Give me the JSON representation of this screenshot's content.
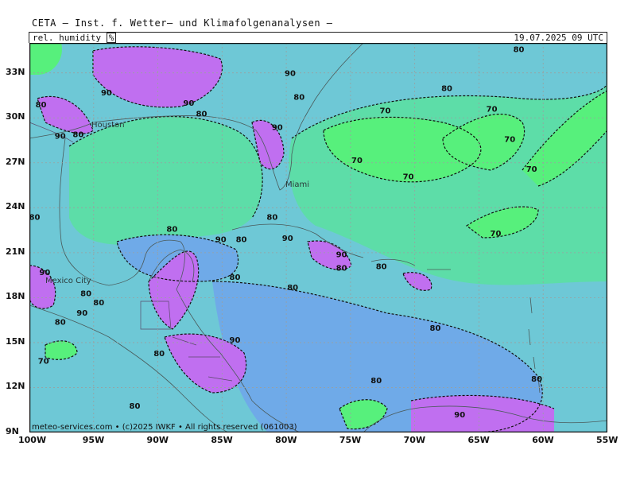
{
  "header": {
    "title": "CETA – Inst. f. Wetter– und Klimafolgenanalysen –",
    "parameter": "rel. humidity",
    "unit": "%",
    "valid_time": "19.07.2025 09 UTC"
  },
  "map": {
    "region": "Gulf of Mexico / Caribbean",
    "lon_range": [
      -100,
      -55
    ],
    "lat_range": [
      9,
      35
    ],
    "lon_ticks": [
      "100W",
      "95W",
      "90W",
      "85W",
      "80W",
      "75W",
      "70W",
      "65W",
      "60W",
      "55W"
    ],
    "lat_ticks": [
      "33N",
      "30N",
      "27N",
      "24N",
      "21N",
      "18N",
      "15N",
      "12N",
      "9N"
    ],
    "city_labels": [
      "Houston",
      "Miami",
      "Mexico City"
    ],
    "contour_labels": [
      {
        "text": "90",
        "lon": -94,
        "lat": 31.5
      },
      {
        "text": "90",
        "lon": -97.6,
        "lat": 28.6
      },
      {
        "text": "80",
        "lon": -96.2,
        "lat": 28.7
      },
      {
        "text": "80",
        "lon": -99.1,
        "lat": 30.7
      },
      {
        "text": "90",
        "lon": -87.6,
        "lat": 30.8
      },
      {
        "text": "80",
        "lon": -86.6,
        "lat": 30.1
      },
      {
        "text": "90",
        "lon": -79.7,
        "lat": 32.8
      },
      {
        "text": "80",
        "lon": -79.0,
        "lat": 31.2
      },
      {
        "text": "90",
        "lon": -80.7,
        "lat": 29.2
      },
      {
        "text": "80",
        "lon": -61.9,
        "lat": 34.4
      },
      {
        "text": "80",
        "lon": -67.5,
        "lat": 31.8
      },
      {
        "text": "70",
        "lon": -72.3,
        "lat": 30.3
      },
      {
        "text": "70",
        "lon": -64.0,
        "lat": 30.4
      },
      {
        "text": "70",
        "lon": -62.6,
        "lat": 28.4
      },
      {
        "text": "70",
        "lon": -74.5,
        "lat": 27.0
      },
      {
        "text": "70",
        "lon": -70.5,
        "lat": 25.9
      },
      {
        "text": "70",
        "lon": -60.9,
        "lat": 26.4
      },
      {
        "text": "70",
        "lon": -63.7,
        "lat": 22.1
      },
      {
        "text": "80",
        "lon": -99.6,
        "lat": 23.2
      },
      {
        "text": "80",
        "lon": -81.1,
        "lat": 23.2
      },
      {
        "text": "80",
        "lon": -88.9,
        "lat": 22.4
      },
      {
        "text": "90",
        "lon": -85.1,
        "lat": 21.7
      },
      {
        "text": "80",
        "lon": -83.5,
        "lat": 21.7
      },
      {
        "text": "90",
        "lon": -79.9,
        "lat": 21.8
      },
      {
        "text": "90",
        "lon": -75.7,
        "lat": 20.7
      },
      {
        "text": "80",
        "lon": -75.7,
        "lat": 19.8
      },
      {
        "text": "80",
        "lon": -72.6,
        "lat": 19.9
      },
      {
        "text": "80",
        "lon": -84.0,
        "lat": 19.2
      },
      {
        "text": "80",
        "lon": -79.5,
        "lat": 18.5
      },
      {
        "text": "90",
        "lon": -98.8,
        "lat": 19.5
      },
      {
        "text": "80",
        "lon": -95.6,
        "lat": 18.1
      },
      {
        "text": "80",
        "lon": -94.6,
        "lat": 17.5
      },
      {
        "text": "80",
        "lon": -97.6,
        "lat": 16.2
      },
      {
        "text": "90",
        "lon": -95.9,
        "lat": 16.8
      },
      {
        "text": "70",
        "lon": -98.9,
        "lat": 13.6
      },
      {
        "text": "90",
        "lon": -84.0,
        "lat": 15.0
      },
      {
        "text": "80",
        "lon": -89.9,
        "lat": 14.1
      },
      {
        "text": "80",
        "lon": -68.4,
        "lat": 15.8
      },
      {
        "text": "80",
        "lon": -73.0,
        "lat": 12.3
      },
      {
        "text": "80",
        "lon": -60.5,
        "lat": 12.4
      },
      {
        "text": "80",
        "lon": -91.8,
        "lat": 10.6
      },
      {
        "text": "90",
        "lon": -66.5,
        "lat": 10.0
      }
    ]
  },
  "colors": {
    "rh_60_70": "#57f07c",
    "rh_70_80": "#5ddda8",
    "rh_80_85": "#6ec8d6",
    "rh_85_90": "#6faae8",
    "rh_90_95": "#7b88ee",
    "rh_95_100": "#c06ff0",
    "contour": "#111111",
    "coast": "#4a5a5a",
    "grid": "#9aa0a0"
  },
  "footer": {
    "credit": "meteo-services.com • (c)2025 IWKF • All rights reserved (061003)"
  }
}
